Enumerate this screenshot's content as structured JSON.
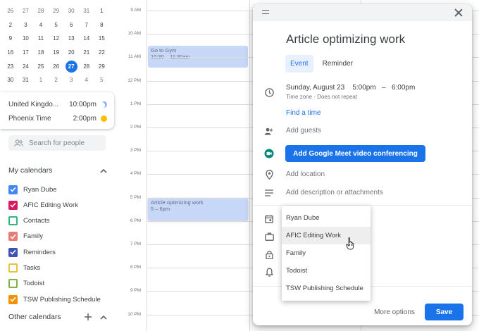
{
  "mini_calendar": {
    "weeks": [
      [
        "26",
        "27",
        "28",
        "29",
        "30",
        "31",
        "1"
      ],
      [
        "2",
        "3",
        "4",
        "5",
        "6",
        "7",
        "8"
      ],
      [
        "9",
        "10",
        "11",
        "12",
        "13",
        "14",
        "15"
      ],
      [
        "16",
        "17",
        "18",
        "19",
        "20",
        "21",
        "22"
      ],
      [
        "23",
        "24",
        "25",
        "26",
        "27",
        "28",
        "29"
      ],
      [
        "30",
        "31",
        "1",
        "2",
        "3",
        "4",
        "5"
      ]
    ],
    "today": "27"
  },
  "world_clock": [
    {
      "name": "United Kingdo...",
      "time": "10:00pm",
      "icon": "moon-icon"
    },
    {
      "name": "Phoenix Time",
      "time": "2:00pm",
      "icon": "sun-icon"
    }
  ],
  "search_people": {
    "placeholder": "Search for people"
  },
  "my_calendars": {
    "title": "My calendars",
    "items": [
      {
        "label": "Ryan Dube",
        "color": "#4285f4",
        "checked": true
      },
      {
        "label": "AFIC Editing Work",
        "color": "#d81b60",
        "checked": true
      },
      {
        "label": "Contacts",
        "color": "#33b679",
        "checked": false
      },
      {
        "label": "Family",
        "color": "#e67c73",
        "checked": true
      },
      {
        "label": "Reminders",
        "color": "#3f51b5",
        "checked": true
      },
      {
        "label": "Tasks",
        "color": "#e4c441",
        "checked": false
      },
      {
        "label": "Todoist",
        "color": "#7cb342",
        "checked": false
      },
      {
        "label": "TSW Publishing Schedule",
        "color": "#f09300",
        "checked": true
      }
    ]
  },
  "other_calendars": {
    "title": "Other calendars"
  },
  "times": [
    "9 AM",
    "10 AM",
    "11 AM",
    "12 PM",
    "1 PM",
    "2 PM",
    "3 PM",
    "4 PM",
    "5 PM",
    "6 PM",
    "7 PM",
    "8 PM",
    "9 PM",
    "10 PM"
  ],
  "events": [
    {
      "title": "Go to Gym",
      "time": "10:30 – 11:30am"
    },
    {
      "title": "Article optimizing work",
      "time": "5 – 6pm"
    }
  ],
  "dialog": {
    "title": "Article optimizing work",
    "tabs": [
      "Event",
      "Reminder"
    ],
    "date": "Sunday, August 23",
    "start": "5:00pm",
    "dash": "–",
    "end": "6:00pm",
    "timezone_note": "Time zone · Does not repeat",
    "find_time": "Find a time",
    "add_guests": "Add guests",
    "meet_button": "Add Google Meet video conferencing",
    "add_location": "Add location",
    "add_description": "Add description or attachments",
    "more_options": "More options",
    "save": "Save"
  },
  "calendar_dropdown": {
    "options": [
      "Ryan Dube",
      "AFIC Editing Work",
      "Family",
      "Todoist",
      "TSW Publishing Schedule"
    ],
    "hovered": "AFIC Editing Work"
  },
  "colors": {
    "accent": "#1a73e8",
    "event_bg": "#c6d7f8"
  }
}
